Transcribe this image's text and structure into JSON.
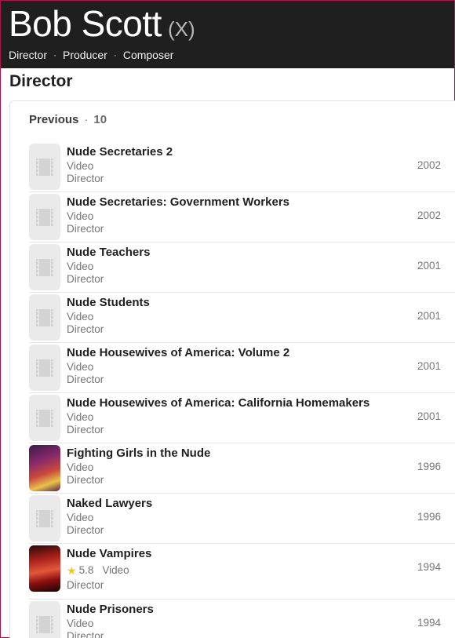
{
  "person": {
    "name": "Bob Scott",
    "suffix": "(X)",
    "roles": [
      "Director",
      "Producer",
      "Composer"
    ]
  },
  "section": {
    "title": "Director",
    "group_label": "Previous",
    "count": "10"
  },
  "credits": [
    {
      "title": "Nude Secretaries 2",
      "type": "Video",
      "role": "Director",
      "year": "2002",
      "poster": "placeholder-film-icon"
    },
    {
      "title": "Nude Secretaries: Government Workers",
      "type": "Video",
      "role": "Director",
      "year": "2002",
      "poster": "placeholder-film-icon"
    },
    {
      "title": "Nude Teachers",
      "type": "Video",
      "role": "Director",
      "year": "2001",
      "poster": "placeholder-film-icon"
    },
    {
      "title": "Nude Students",
      "type": "Video",
      "role": "Director",
      "year": "2001",
      "poster": "placeholder-film-icon"
    },
    {
      "title": "Nude Housewives of America: Volume 2",
      "type": "Video",
      "role": "Director",
      "year": "2001",
      "poster": "placeholder-film-icon"
    },
    {
      "title": "Nude Housewives of America: California Homemakers",
      "type": "Video",
      "role": "Director",
      "year": "2001",
      "poster": "placeholder-film-icon"
    },
    {
      "title": "Fighting Girls in the Nude",
      "type": "Video",
      "role": "Director",
      "year": "1996",
      "poster": "poster-image"
    },
    {
      "title": "Naked Lawyers",
      "type": "Video",
      "role": "Director",
      "year": "1996",
      "poster": "placeholder-film-icon"
    },
    {
      "title": "Nude Vampires",
      "rating": "5.8",
      "type": "Video",
      "role": "Director",
      "year": "1994",
      "poster": "poster-image"
    },
    {
      "title": "Nude Prisoners",
      "type": "Video",
      "role": "Director",
      "year": "1994",
      "poster": "placeholder-film-icon"
    }
  ],
  "colors": {
    "hero_bg": "#1f1f1f",
    "star": "#f5c518",
    "border_accent": "#b0124a"
  }
}
